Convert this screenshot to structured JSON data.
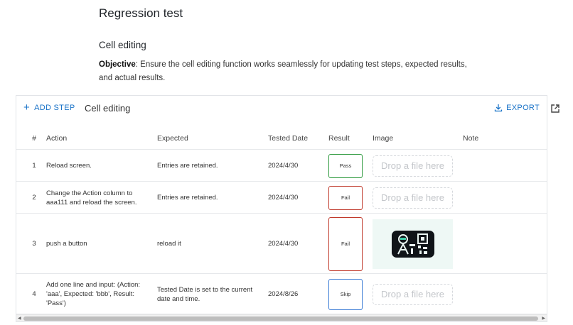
{
  "page": {
    "title": "Regression test",
    "section_title": "Cell editing",
    "objective_label": "Objective",
    "objective_text": ": Ensure the cell editing function works seamlessly for updating test steps, expected results, and actual results."
  },
  "toolbar": {
    "add_step_label": "ADD STEP",
    "grid_name": "Cell editing",
    "export_label": "EXPORT"
  },
  "columns": {
    "num": "#",
    "action": "Action",
    "expected": "Expected",
    "tested_date": "Tested Date",
    "result": "Result",
    "image": "Image",
    "note": "Note"
  },
  "rows": [
    {
      "num": "1",
      "action": "Reload screen.",
      "expected": "Entries are retained.",
      "tested_date": "2024/4/30",
      "result": "Pass",
      "image_placeholder": "Drop a file here",
      "note": ""
    },
    {
      "num": "2",
      "action": "Change the Action column to aaa111 and reload the screen.",
      "expected": "Entries are retained.",
      "tested_date": "2024/4/30",
      "result": "Fail",
      "image_placeholder": "Drop a file here",
      "note": ""
    },
    {
      "num": "3",
      "action": "push a button",
      "expected": "reload it",
      "tested_date": "2024/4/30",
      "result": "Fail",
      "image_placeholder": "",
      "note": ""
    },
    {
      "num": "4",
      "action": "Add one line and input: (Action: 'aaa', Expected: 'bbb', Result: 'Pass')",
      "expected": "Tested Date is set to the current date and time.",
      "tested_date": "2024/8/26",
      "result": "Skip",
      "image_placeholder": "Drop a file here",
      "note": ""
    }
  ],
  "colors": {
    "accent": "#1a73c8",
    "pass": "#2e9a3e",
    "fail": "#c0392b",
    "skip": "#3a7bd5"
  },
  "icons": {
    "add": "plus-icon",
    "export": "download-icon",
    "popout": "open-in-new-icon",
    "thumbnail": "qr-code-robot-icon"
  }
}
